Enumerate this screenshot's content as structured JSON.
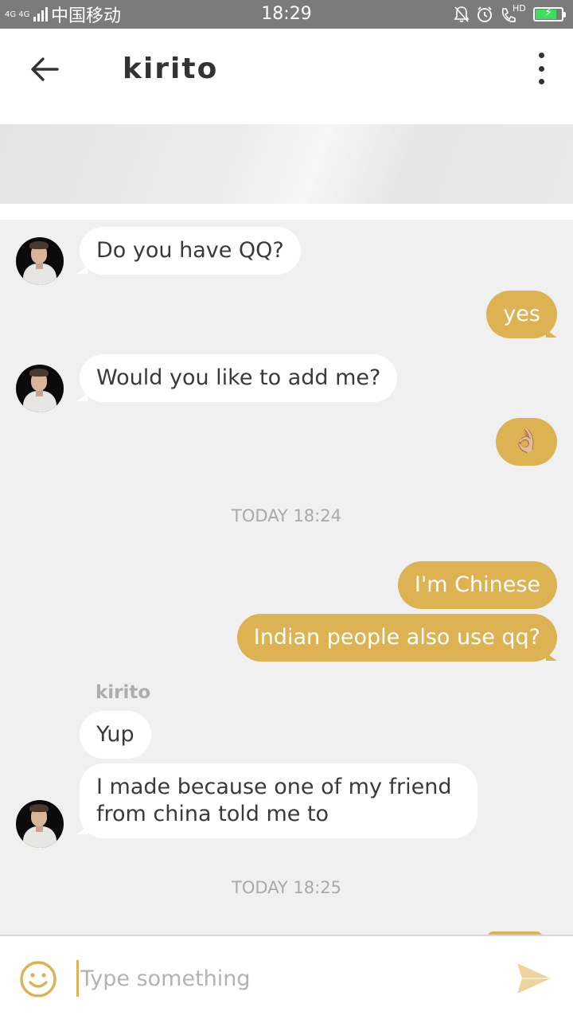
{
  "status_bar": {
    "network": "4G 4G",
    "carrier": "中国移动",
    "time": "18:29",
    "hd_label": "HD",
    "icons": [
      "signal-icon",
      "bell-muted-icon",
      "alarm-icon",
      "phone-hd-icon",
      "battery-charging-icon"
    ],
    "battery_level": 0.8
  },
  "header": {
    "title": "kirito",
    "back_icon": "arrow-left-icon",
    "menu_icon": "more-vertical-icon"
  },
  "messages": [
    {
      "side": "in",
      "text": "Do you have QQ?",
      "avatar": true
    },
    {
      "side": "out",
      "text": "yes"
    },
    {
      "side": "in",
      "text": "Would you like to add me?",
      "avatar": true
    },
    {
      "side": "out",
      "text": "👌🏼"
    },
    {
      "type": "timestamp",
      "text": "TODAY 18:24"
    },
    {
      "side": "out",
      "text": "I'm Chinese"
    },
    {
      "side": "out",
      "text": "Indian people also use qq?"
    },
    {
      "type": "sender",
      "text": "kirito"
    },
    {
      "side": "in",
      "text": "Yup"
    },
    {
      "side": "in",
      "text_lines": [
        "I made because one of my friend",
        "from china told me to"
      ],
      "avatar": true
    },
    {
      "type": "timestamp",
      "text": "TODAY 18:25"
    }
  ],
  "composer": {
    "placeholder": "Type something",
    "value": "",
    "emoji_icon": "smiley-icon",
    "send_icon": "send-icon"
  },
  "colors": {
    "accent": "#ddb253",
    "status_bar": "#7b7b7b",
    "background": "#f0f0f0",
    "incoming_bubble": "#ffffff",
    "timestamp": "#a9a9a9"
  }
}
